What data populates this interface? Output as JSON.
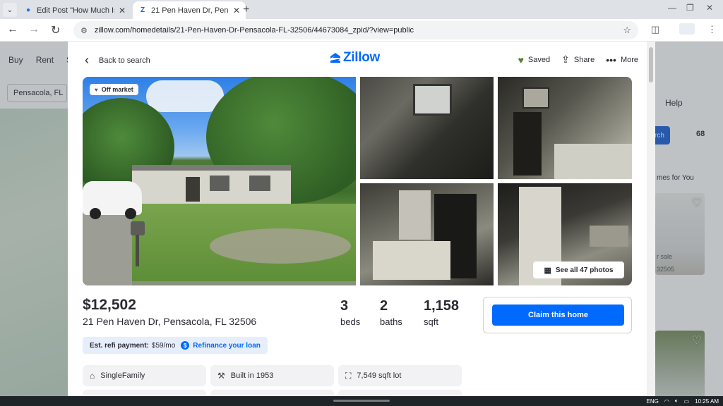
{
  "browser": {
    "tabs": [
      {
        "title": "Edit Post \"How Much Is My I",
        "favicon": "map-pin-icon"
      },
      {
        "title": "21 Pen Haven Dr, Pensacola",
        "favicon": "zillow-icon"
      }
    ],
    "url": "zillow.com/homedetails/21-Pen-Haven-Dr-Pensacola-FL-32506/44673084_zpid/?view=public"
  },
  "background": {
    "nav": [
      "Buy",
      "Rent",
      "S"
    ],
    "search": "Pensacola, FL",
    "search_btn": "rch",
    "count": "68",
    "help": "Help",
    "homes_for_you": "mes for You",
    "card_text": "r sale",
    "card_price": "32505"
  },
  "modal": {
    "back_label": "Back to search",
    "logo": "Zillow",
    "actions": {
      "saved": "Saved",
      "share": "Share",
      "more": "More"
    },
    "badge": "Off market",
    "see_all": "See all 47 photos",
    "price": "$12,502",
    "address": "21 Pen Haven Dr, Pensacola, FL 32506",
    "stats": [
      {
        "value": "3",
        "label": "beds"
      },
      {
        "value": "2",
        "label": "baths"
      },
      {
        "value": "1,158",
        "label": "sqft"
      }
    ],
    "claim": "Claim this home",
    "refi": {
      "label": "Est. refi payment:",
      "value": "$59/mo",
      "link": "Refinance your loan"
    },
    "facts": [
      {
        "icon": "home-icon",
        "label": "SingleFamily"
      },
      {
        "icon": "hammer-icon",
        "label": "Built in 1953"
      },
      {
        "icon": "lot-icon",
        "label": "7,549 sqft lot"
      }
    ]
  },
  "taskbar": {
    "lang": "ENG",
    "time": "10:25 AM"
  }
}
